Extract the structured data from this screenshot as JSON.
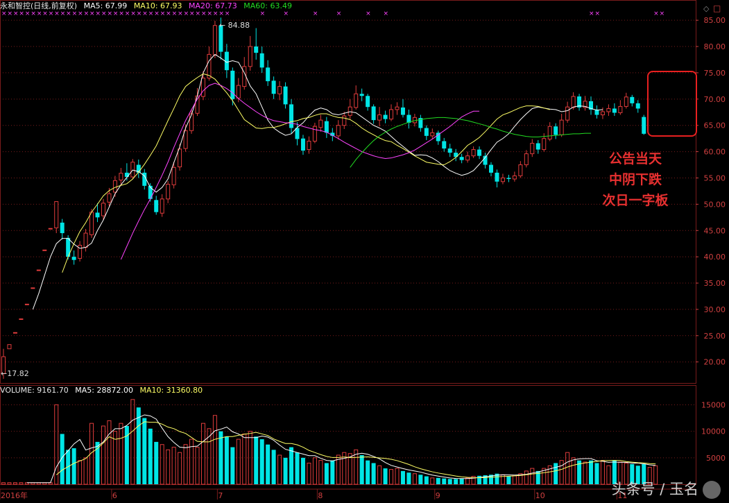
{
  "header": {
    "stock": "永和智控(日线,前复权)",
    "ma5": "MA5: 67.99",
    "ma10": "MA10: 67.93",
    "ma20": "MA20: 67.73",
    "ma60": "MA60: 63.49"
  },
  "volume_header": {
    "label": "VOLUME: 9161.70",
    "ma5": "MA5: 28872.00",
    "ma10": "MA10: 31360.80"
  },
  "annotation": {
    "line1": "公告当天",
    "line2": "中阴下跌",
    "line3": "次日一字板"
  },
  "watermark": "头条号 / 玉名",
  "period_label": "日线",
  "colors": {
    "up": "#e03c3c",
    "down": "#00e5e5",
    "ma5": "#ffffff",
    "ma10": "#ffff66",
    "ma20": "#ff44ff",
    "ma60": "#22dd22",
    "grid": "#7a1c1c",
    "axis_text": "#d04040",
    "highlight_box": "#e82020"
  },
  "chart_data": [
    {
      "type": "candlestick",
      "title": "永和智控(日线,前复权)",
      "y_ticks": [
        20,
        25,
        30,
        35,
        40,
        45,
        50,
        55,
        60,
        65,
        70,
        75,
        80,
        85
      ],
      "ylim": [
        16,
        87
      ],
      "x_labels": [
        "2016年",
        "6",
        "7",
        "8",
        "9",
        "10",
        "11"
      ],
      "high_label": "84.88",
      "low_label": "17.82",
      "candles": [
        [
          17.8,
          21,
          16.8,
          22.5
        ],
        [
          22.5,
          23.3,
          22.5,
          23.3
        ],
        [
          25.6,
          25.6,
          25.6,
          25.6
        ],
        [
          28.2,
          28.2,
          28.2,
          28.2
        ],
        [
          31,
          31,
          31,
          31
        ],
        [
          34.1,
          34.1,
          34.1,
          34.1
        ],
        [
          37.5,
          37.5,
          37.5,
          37.5
        ],
        [
          41.3,
          41.3,
          41.3,
          41.3
        ],
        [
          45.4,
          45.4,
          45.4,
          45.4
        ],
        [
          45.5,
          50.5,
          44.5,
          46
        ],
        [
          46.5,
          44.5,
          43.3,
          47.2
        ],
        [
          43.6,
          40,
          39.5,
          44.1
        ],
        [
          40,
          39.4,
          38.5,
          41.2
        ],
        [
          39.7,
          42.2,
          39.1,
          43
        ],
        [
          41.8,
          44.5,
          41,
          45.3
        ],
        [
          44.2,
          48.5,
          43.6,
          49.1
        ],
        [
          48.4,
          47.5,
          46.6,
          50.2
        ],
        [
          47.8,
          50.2,
          47,
          51
        ],
        [
          50.4,
          52,
          49.6,
          53.1
        ],
        [
          52.3,
          54.5,
          51.4,
          55.4
        ],
        [
          54.6,
          55.9,
          53.5,
          56.9
        ],
        [
          56,
          55.2,
          54.5,
          57.8
        ],
        [
          55.2,
          58,
          54.8,
          58.6
        ],
        [
          57.5,
          56,
          55,
          58.5
        ],
        [
          56,
          53.5,
          52.8,
          56.7
        ],
        [
          53.5,
          51,
          50.5,
          54
        ],
        [
          50.8,
          48.5,
          48,
          51.6
        ],
        [
          48.3,
          51,
          47.6,
          51.9
        ],
        [
          51,
          53.8,
          50.2,
          54.4
        ],
        [
          53.7,
          57,
          53,
          58.1
        ],
        [
          57.1,
          60.5,
          56.4,
          61.5
        ],
        [
          60.6,
          64,
          60,
          65.2
        ],
        [
          64,
          67.2,
          63.4,
          68
        ],
        [
          67.3,
          70.6,
          66.8,
          72.1
        ],
        [
          70.5,
          74,
          69.8,
          75.3
        ],
        [
          74,
          78.5,
          73.5,
          80
        ],
        [
          78.4,
          84,
          77.8,
          84.9
        ],
        [
          84,
          79,
          77.5,
          85.5
        ],
        [
          79,
          75.5,
          74,
          80.5
        ],
        [
          75.4,
          70,
          68.8,
          76
        ],
        [
          70.2,
          72.6,
          69.4,
          74
        ],
        [
          72.4,
          76.2,
          71.8,
          78
        ],
        [
          76.2,
          80,
          75.4,
          82
        ],
        [
          80,
          78.8,
          77.5,
          83.5
        ],
        [
          78.7,
          76,
          75,
          80
        ],
        [
          76,
          73.4,
          72.5,
          77.4
        ],
        [
          73.5,
          71,
          70,
          74.3
        ],
        [
          71,
          72.4,
          69.8,
          73.4
        ],
        [
          72.4,
          69,
          68.2,
          73.2
        ],
        [
          69,
          64.5,
          63.5,
          70
        ],
        [
          64.5,
          62.4,
          61.2,
          65.6
        ],
        [
          62.5,
          60.2,
          59.4,
          63.2
        ],
        [
          60.4,
          62,
          59.6,
          62.9
        ],
        [
          62,
          64.8,
          61.6,
          65.5
        ],
        [
          64.6,
          66,
          63.8,
          67
        ],
        [
          65.8,
          63.6,
          62.6,
          66.6
        ],
        [
          63.6,
          63,
          62,
          64.5
        ],
        [
          63,
          65,
          62.3,
          66
        ],
        [
          65,
          66.8,
          64.3,
          67.6
        ],
        [
          66.9,
          68.5,
          66.2,
          70
        ],
        [
          68.4,
          71,
          68,
          72.6
        ],
        [
          71,
          70.6,
          69.6,
          72
        ],
        [
          70.6,
          68.5,
          67.8,
          71
        ],
        [
          68.6,
          66,
          65.3,
          69
        ],
        [
          66,
          67,
          64.8,
          68.5
        ],
        [
          67,
          66.2,
          65.4,
          67.8
        ],
        [
          66.2,
          68,
          65.8,
          69
        ],
        [
          68,
          68.5,
          67,
          69.4
        ],
        [
          68.4,
          67,
          66.5,
          70
        ],
        [
          67,
          65.5,
          64.4,
          68
        ],
        [
          65.5,
          66.5,
          64.8,
          67.2
        ],
        [
          66.4,
          64.5,
          63.8,
          67
        ],
        [
          64.5,
          63,
          62.2,
          65
        ],
        [
          63,
          63.6,
          62.4,
          64.4
        ],
        [
          63.6,
          62,
          61.3,
          64
        ],
        [
          62,
          60.6,
          60,
          62.6
        ],
        [
          60.6,
          59.8,
          59,
          61.5
        ],
        [
          59.8,
          59,
          58.2,
          60.5
        ],
        [
          59,
          58.4,
          57.8,
          59.6
        ],
        [
          58.4,
          59.2,
          57.9,
          60
        ],
        [
          59.2,
          60.4,
          58.8,
          61
        ],
        [
          60.4,
          59.2,
          58.6,
          61
        ],
        [
          59.2,
          57.5,
          56.8,
          59.8
        ],
        [
          57.5,
          56,
          55.3,
          58
        ],
        [
          56,
          54.3,
          53.2,
          56.6
        ],
        [
          54.3,
          55,
          53.8,
          55.8
        ],
        [
          55,
          54.8,
          54.2,
          55.6
        ],
        [
          54.8,
          55.4,
          54.3,
          56.2
        ],
        [
          55.4,
          57.5,
          55,
          58.2
        ],
        [
          57.5,
          59.6,
          57,
          60.3
        ],
        [
          59.6,
          61.6,
          59,
          62.4
        ],
        [
          61.6,
          60.4,
          59.6,
          62.2
        ],
        [
          60.4,
          62.5,
          60,
          63.5
        ],
        [
          62.4,
          64.8,
          62,
          65.6
        ],
        [
          64.8,
          63.2,
          62.4,
          65.4
        ],
        [
          63.2,
          66,
          62.8,
          67.2
        ],
        [
          66,
          68.5,
          65.5,
          69.5
        ],
        [
          68.4,
          70.5,
          68,
          71.3
        ],
        [
          70.5,
          68.4,
          67.8,
          71
        ],
        [
          68.4,
          69.6,
          67.8,
          70.6
        ],
        [
          69.6,
          68,
          67,
          70.5
        ],
        [
          68,
          67,
          66.3,
          68.8
        ],
        [
          67,
          67.6,
          66.2,
          68.4
        ],
        [
          67.6,
          68.2,
          66.8,
          69
        ],
        [
          68.2,
          67.4,
          66.8,
          69.2
        ],
        [
          67.4,
          68.6,
          67,
          69.8
        ],
        [
          68.6,
          70.4,
          68.2,
          71.2
        ],
        [
          70.4,
          69.2,
          68.6,
          70.8
        ],
        [
          69.2,
          68.2,
          67.4,
          69.8
        ],
        [
          66.6,
          63.4,
          63.2,
          67
        ]
      ],
      "ma_series": [
        {
          "name": "MA5",
          "start": 5,
          "values": [
            30,
            33,
            36.5,
            40,
            42.5,
            43.5,
            43.5,
            42.4,
            41.6,
            41.8,
            42.6,
            45,
            47,
            49.5,
            52,
            53.7,
            55.1,
            56.5,
            56.2,
            55.4,
            53.2,
            52.3,
            53.2,
            54.8,
            57.9,
            60.9,
            64.5,
            67,
            70.6,
            75,
            77.3,
            78.5,
            77.8,
            77,
            77.3,
            77,
            75,
            72.5,
            71,
            68.5,
            66,
            64.5,
            63.7,
            63.1,
            63.4,
            64.6,
            65.5,
            66.8,
            67.9,
            68.3,
            68,
            67.2,
            67,
            67.3,
            67.6,
            67.4,
            66.6,
            65.8,
            65,
            64.5,
            63.9,
            62.9,
            61.9,
            61,
            60.1,
            59.3,
            59.4,
            59.3,
            58.8,
            58.1,
            57.2,
            56.4,
            55.9,
            55.5,
            55.8,
            56.4,
            57.6,
            58.9,
            60.4,
            61.8,
            62.5,
            63.4,
            64.8,
            66.1,
            67.2,
            68.2,
            68.5,
            68.3,
            68.1,
            68,
            67.6,
            67.8,
            68.5,
            68.7,
            68.6,
            68.2,
            67.9,
            68
          ]
        },
        {
          "name": "MA10",
          "start": 10,
          "values": [
            37,
            40,
            42.5,
            44.8,
            46.5,
            48.5,
            50,
            51.6,
            52.6,
            53.2,
            53.6,
            53.9,
            54.8,
            56.1,
            57.6,
            59.3,
            61.1,
            63.5,
            65.9,
            68.2,
            70.6,
            72.4,
            73.3,
            74.1,
            74.8,
            74.5,
            73.8,
            72.5,
            71.2,
            69.7,
            67.9,
            66.1,
            65.3,
            64.5,
            64.4,
            64.6,
            64.6,
            64.9,
            65.3,
            65.7,
            65.9,
            66.3,
            66.5,
            66.9,
            67.2,
            67.2,
            66.8,
            66.5,
            66.4,
            66.1,
            65.4,
            64.5,
            63.8,
            63.2,
            62.6,
            62.1,
            61.9,
            61.2,
            60.6,
            59.9,
            59.2,
            58.6,
            58,
            57.8,
            57.6,
            57.5,
            58.1,
            58.9,
            60,
            61.2,
            61.9,
            62.7,
            63.8,
            65,
            66.2,
            67,
            67.4,
            67.9,
            68.4,
            68.7,
            68.7,
            68.6,
            68.3,
            68
          ]
        },
        {
          "name": "MA20",
          "start": 20,
          "values": [
            39.5,
            42,
            44.5,
            46.8,
            49,
            51,
            53.2,
            55.5,
            58,
            60.8,
            63.4,
            65.9,
            68,
            70,
            71.6,
            72.6,
            73,
            72.6,
            72,
            71.2,
            70.1,
            69.2,
            68.4,
            67.6,
            66.9,
            66.3,
            65.9,
            65.7,
            65.5,
            65.4,
            65.2,
            64.8,
            64.5,
            64.2,
            64,
            63.7,
            63.1,
            62.5,
            61.8,
            61.2,
            60.6,
            60,
            59.6,
            59.2,
            58.9,
            58.7,
            58.8,
            59.1,
            59.4,
            59.8,
            60.3,
            61,
            61.7,
            62.4,
            63.2,
            64,
            64.8,
            65.7,
            66.6,
            67.2,
            67.7,
            67.7
          ]
        },
        {
          "name": "MA60",
          "start": 59,
          "values": [
            57,
            58.5,
            59.8,
            61,
            62.1,
            63,
            63.7,
            64.3,
            64.8,
            65.2,
            65.6,
            65.9,
            66.1,
            66.3,
            66.4,
            66.5,
            66.5,
            66.4,
            66.3,
            66.1,
            65.9,
            65.6,
            65.3,
            65,
            64.6,
            64.3,
            63.9,
            63.6,
            63.3,
            63.1,
            62.9,
            62.8,
            62.8,
            62.9,
            63,
            63.1,
            63.2,
            63.3,
            63.4,
            63.4,
            63.5,
            63.5
          ]
        }
      ]
    },
    {
      "type": "bar",
      "title": "VOLUME",
      "y_ticks": [
        5000,
        10000,
        15000
      ],
      "ylim": [
        0,
        16500
      ],
      "volumes": [
        300,
        300,
        300,
        300,
        300,
        300,
        300,
        300,
        300,
        15000,
        9500,
        6500,
        6800,
        4500,
        5000,
        11500,
        8000,
        11000,
        12000,
        10000,
        11500,
        11000,
        16000,
        14500,
        12500,
        10500,
        8000,
        7500,
        6500,
        7000,
        6000,
        7500,
        8500,
        7000,
        11500,
        10500,
        13000,
        10000,
        9000,
        7000,
        8500,
        9500,
        10000,
        9000,
        8500,
        7500,
        6500,
        5500,
        5000,
        7000,
        6000,
        5000,
        4000,
        5000,
        4500,
        4000,
        4500,
        5500,
        6000,
        5800,
        6500,
        5500,
        4500,
        4000,
        3500,
        3000,
        2800,
        3000,
        2500,
        2200,
        2000,
        1800,
        1500,
        1200,
        1200,
        1100,
        1000,
        1000,
        1100,
        1200,
        1500,
        1600,
        1700,
        1800,
        2000,
        1800,
        1500,
        1600,
        2000,
        2500,
        3000,
        2500,
        3000,
        3500,
        4000,
        4500,
        6000,
        5000,
        4500,
        4200,
        4500,
        4000,
        4500,
        3500,
        4500,
        4200,
        4000,
        3800,
        3500,
        3800,
        3200,
        3500
      ]
    }
  ]
}
